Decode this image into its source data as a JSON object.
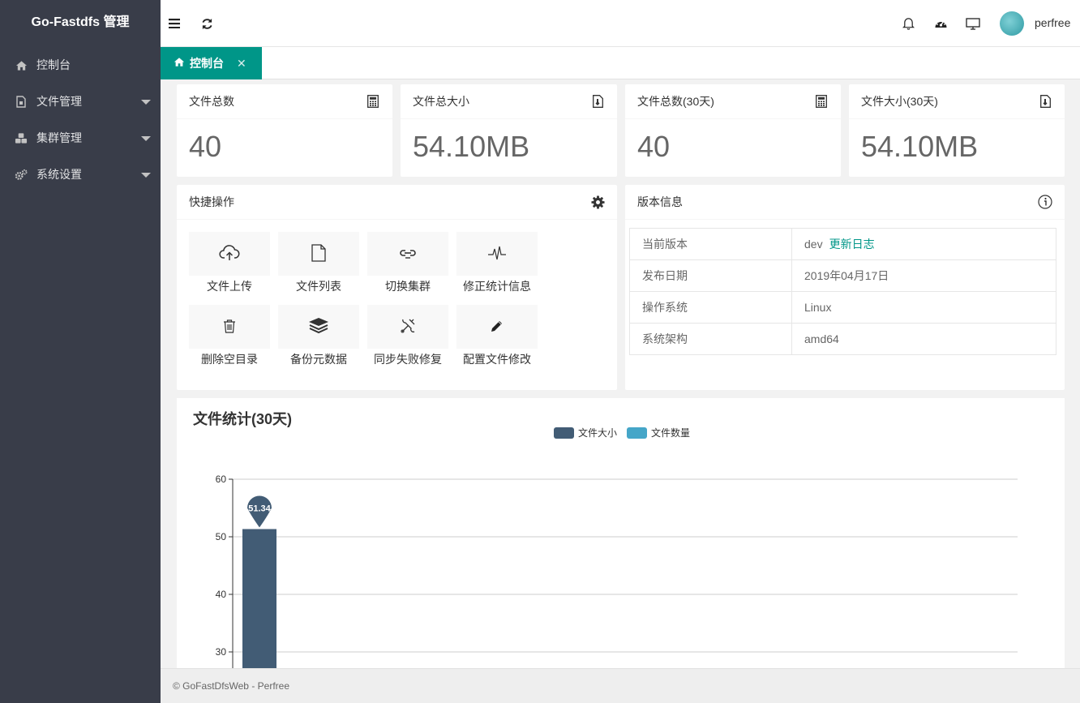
{
  "app": {
    "title": "Go-Fastdfs 管理"
  },
  "sidebar": {
    "items": [
      {
        "label": "控制台",
        "icon": "home-icon",
        "has_children": false
      },
      {
        "label": "文件管理",
        "icon": "file-icon",
        "has_children": true
      },
      {
        "label": "集群管理",
        "icon": "cluster-icon",
        "has_children": true
      },
      {
        "label": "系统设置",
        "icon": "gears-icon",
        "has_children": true
      }
    ]
  },
  "header": {
    "username": "perfree"
  },
  "tabs": [
    {
      "label": "控制台",
      "icon": "home-icon",
      "active": true
    }
  ],
  "stats": [
    {
      "title": "文件总数",
      "value": "40",
      "icon": "calculator-icon"
    },
    {
      "title": "文件总大小",
      "value": "54.10MB",
      "icon": "file-size-icon"
    },
    {
      "title": "文件总数(30天)",
      "value": "40",
      "icon": "calculator-icon"
    },
    {
      "title": "文件大小(30天)",
      "value": "54.10MB",
      "icon": "file-size-icon"
    }
  ],
  "quick_actions": {
    "title": "快捷操作",
    "items": [
      {
        "label": "文件上传",
        "icon": "cloud-upload-icon"
      },
      {
        "label": "文件列表",
        "icon": "file-icon"
      },
      {
        "label": "切换集群",
        "icon": "link-icon"
      },
      {
        "label": "修正统计信息",
        "icon": "pulse-icon"
      },
      {
        "label": "删除空目录",
        "icon": "trash-icon"
      },
      {
        "label": "备份元数据",
        "icon": "layers-icon"
      },
      {
        "label": "同步失败修复",
        "icon": "tools-icon"
      },
      {
        "label": "配置文件修改",
        "icon": "pencil-icon"
      }
    ]
  },
  "version": {
    "title": "版本信息",
    "rows": [
      {
        "key": "当前版本",
        "value": "dev",
        "link": "更新日志"
      },
      {
        "key": "发布日期",
        "value": "2019年04月17日"
      },
      {
        "key": "操作系统",
        "value": "Linux"
      },
      {
        "key": "系统架构",
        "value": "amd64"
      }
    ]
  },
  "chart_data": {
    "type": "bar",
    "title": "文件统计(30天)",
    "legend": [
      "文件大小",
      "文件数量"
    ],
    "series": [
      {
        "name": "文件大小",
        "color": "#425c75",
        "values": [
          51.34
        ]
      },
      {
        "name": "文件数量",
        "color": "#45a6c8",
        "values": []
      }
    ],
    "y_ticks_visible": [
      60,
      50,
      40,
      30
    ],
    "ylim": [
      0,
      60
    ],
    "marker": {
      "series": "文件大小",
      "value": "51.34"
    }
  },
  "footer": {
    "text": "© GoFastDfsWeb - Perfree"
  }
}
